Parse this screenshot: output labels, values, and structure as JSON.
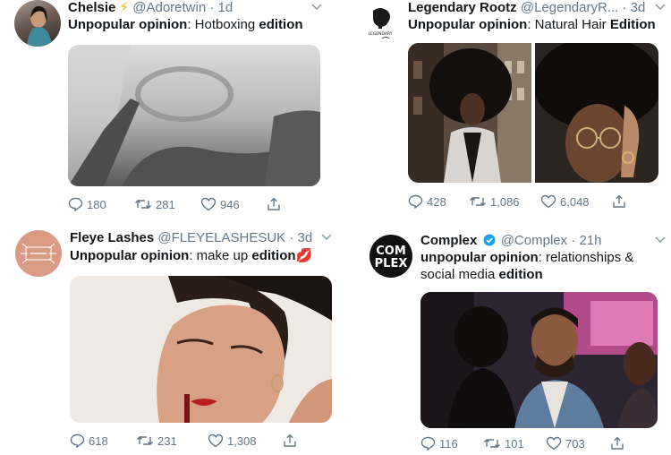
{
  "tweets": [
    {
      "name": "Chelsie",
      "name_emoji": "⚡",
      "handle": "@Adoretwin",
      "sep": "·",
      "time": "1d",
      "text_bold": "Unpopular opinion",
      "text_rest": ": Hotboxing ",
      "text_tail": "edition",
      "replies": "180",
      "retweets": "281",
      "likes": "946"
    },
    {
      "name": "Legendary Rootz",
      "handle": "@LegendaryR...",
      "sep": "·",
      "time": "3d",
      "text_bold": "Unpopular opinion",
      "text_rest": ": Natural Hair ",
      "text_tail": "Edition",
      "replies": "428",
      "retweets": "1,086",
      "likes": "6,048"
    },
    {
      "name": "Fleye Lashes",
      "handle": "@FLEYELASHESUK",
      "sep": "·",
      "time": "3d",
      "text_bold": "Unpopular opinion",
      "text_rest": ": make up ",
      "text_tail": "edition",
      "text_emoji": "💋",
      "replies": "618",
      "retweets": "231",
      "likes": "1,308"
    },
    {
      "name": "Complex",
      "handle": "@Complex",
      "sep": "·",
      "time": "21h",
      "text_bold": "unpopular opinion",
      "text_rest": ": relationships &",
      "text_line2": "social media ",
      "text_tail": "edition",
      "replies": "116",
      "retweets": "101",
      "likes": "703"
    }
  ],
  "logos": {
    "complex_top": "COM",
    "complex_bottom": "PLEX",
    "legendary": "LEGENDARY"
  },
  "colors": {
    "name": "#14171a",
    "secondary": "#657786",
    "verified": "#1da1f2"
  }
}
